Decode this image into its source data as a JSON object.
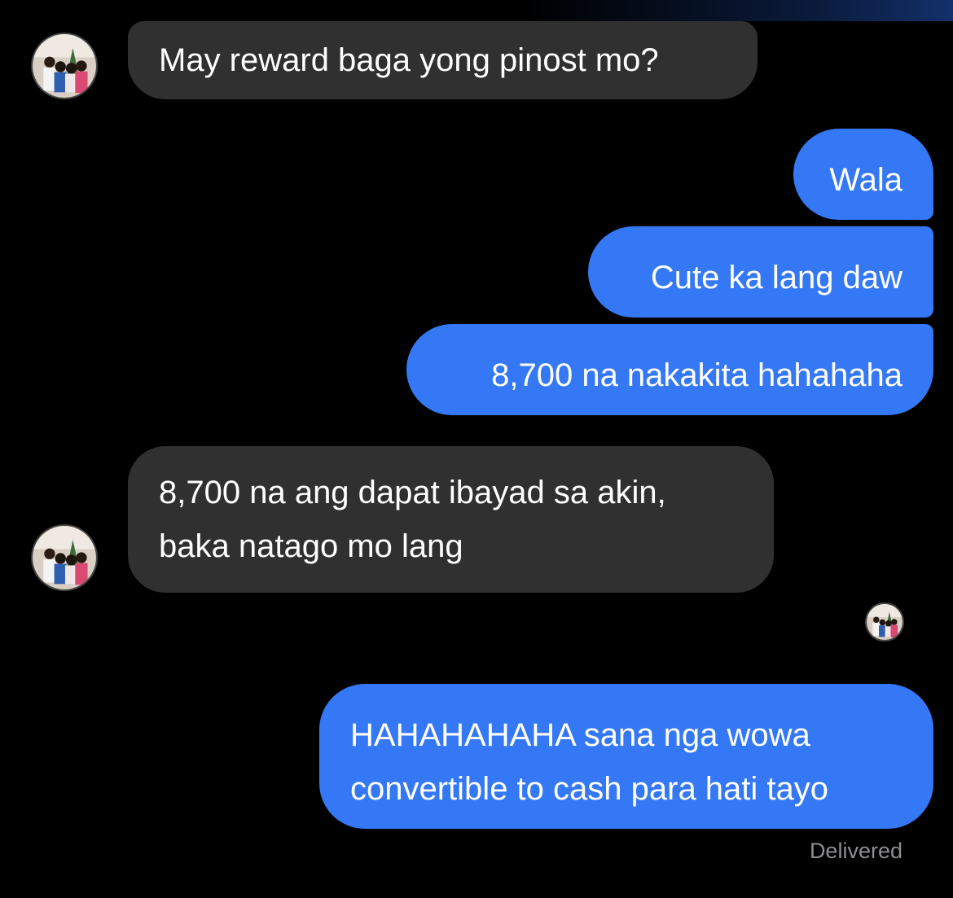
{
  "messages": [
    {
      "sender": "them",
      "text": "May reward baga yong pinost mo?"
    },
    {
      "sender": "me",
      "text": "Wala"
    },
    {
      "sender": "me",
      "text": "Cute ka lang daw"
    },
    {
      "sender": "me",
      "text": "8,700 na nakakita hahahaha"
    },
    {
      "sender": "them",
      "lines": [
        "8,700 na ang dapat ibayad sa akin,",
        "baka natago mo lang"
      ]
    },
    {
      "sender": "me",
      "lines": [
        "HAHAHAHAHA sana nga wowa",
        "convertible to cash para hati tayo"
      ]
    }
  ],
  "status": "Delivered",
  "colors": {
    "background": "#000000",
    "incoming_bubble": "#303030",
    "outgoing_bubble": "#3478f6",
    "status_text": "#8e8e93"
  },
  "icons": {
    "contact_avatar": "group-photo-avatar",
    "read_receipt_avatar": "group-photo-avatar"
  }
}
